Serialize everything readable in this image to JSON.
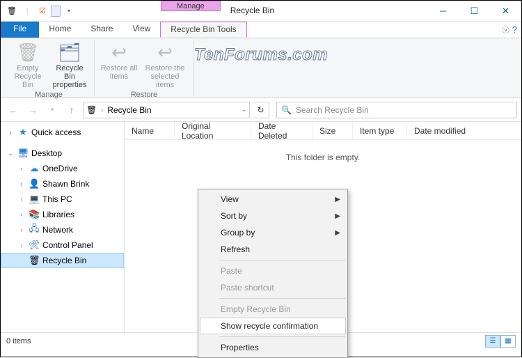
{
  "window": {
    "title": "Recycle Bin",
    "contextual_tab_header": "Manage"
  },
  "tabs": {
    "file": "File",
    "home": "Home",
    "share": "Share",
    "view": "View",
    "tools": "Recycle Bin Tools"
  },
  "ribbon": {
    "empty": "Empty Recycle Bin",
    "props": "Recycle Bin properties",
    "restore_all": "Restore all items",
    "restore_sel": "Restore the selected items",
    "group_manage": "Manage",
    "group_restore": "Restore"
  },
  "nav": {
    "location": "Recycle Bin",
    "search_placeholder": "Search Recycle Bin"
  },
  "sidebar": {
    "quick": "Quick access",
    "desktop": "Desktop",
    "onedrive": "OneDrive",
    "user": "Shawn Brink",
    "thispc": "This PC",
    "libraries": "Libraries",
    "network": "Network",
    "cpanel": "Control Panel",
    "rbin": "Recycle Bin"
  },
  "columns": {
    "name": "Name",
    "orig": "Original Location",
    "deleted": "Date Deleted",
    "size": "Size",
    "type": "Item type",
    "modified": "Date modified"
  },
  "content": {
    "empty": "This folder is empty."
  },
  "status": {
    "items": "0 items"
  },
  "context_menu": {
    "view": "View",
    "sort": "Sort by",
    "group": "Group by",
    "refresh": "Refresh",
    "paste": "Paste",
    "paste_shortcut": "Paste shortcut",
    "empty": "Empty Recycle Bin",
    "confirm": "Show recycle confirmation",
    "properties": "Properties"
  },
  "watermark": "TenForums.com"
}
